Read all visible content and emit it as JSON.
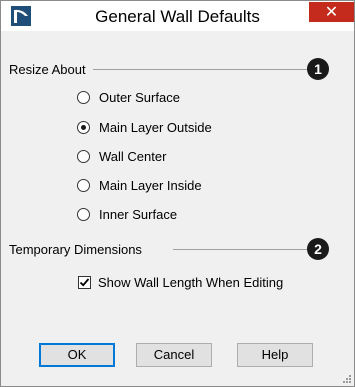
{
  "window": {
    "title": "General Wall Defaults",
    "close_glyph": "✕"
  },
  "resize_about": {
    "label": "Resize About",
    "callout": "1",
    "options": [
      {
        "label": "Outer Surface",
        "selected": false
      },
      {
        "label": "Main Layer Outside",
        "selected": true
      },
      {
        "label": "Wall Center",
        "selected": false
      },
      {
        "label": "Main Layer Inside",
        "selected": false
      },
      {
        "label": "Inner Surface",
        "selected": false
      }
    ]
  },
  "temporary_dimensions": {
    "label": "Temporary Dimensions",
    "callout": "2",
    "show_wall_length": {
      "label": "Show Wall Length When Editing",
      "checked": true
    }
  },
  "buttons": {
    "ok": "OK",
    "cancel": "Cancel",
    "help": "Help"
  },
  "colors": {
    "close_button": "#c42b1c",
    "default_button_border": "#0078d7",
    "app_icon": "#1f4e79"
  },
  "icons": {
    "app": "app-logo-icon",
    "close": "close-icon",
    "resize_grip": "resize-grip-icon",
    "checkmark": "checkmark-icon"
  }
}
